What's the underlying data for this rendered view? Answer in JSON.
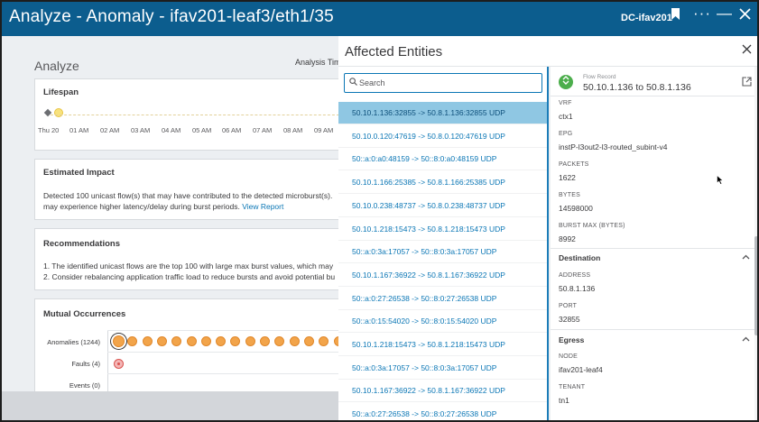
{
  "window": {
    "title": "Analyze - Anomaly - ifav201-leaf3/eth1/35",
    "site": "DC-ifav201"
  },
  "analyze": {
    "heading": "Analyze",
    "analysis_time_label": "Analysis Tim",
    "lifespan": {
      "title": "Lifespan",
      "time_labels": [
        "Thu 20",
        "01 AM",
        "02 AM",
        "03 AM",
        "04 AM",
        "05 AM",
        "06 AM",
        "07 AM",
        "08 AM",
        "09 AM"
      ]
    },
    "estimated_impact": {
      "title": "Estimated Impact",
      "line1": "Detected 100 unicast flow(s) that may have contributed to the detected microburst(s).",
      "line2": "may experience higher latency/delay during burst periods.",
      "link": "View Report"
    },
    "recommendations": {
      "title": "Recommendations",
      "line1": "1. The identified unicast flows are the top 100 with large max burst values, which may",
      "line2": "2. Consider rebalancing application traffic load to reduce bursts and avoid potential bu"
    },
    "mutual_occurrences": {
      "title": "Mutual Occurrences",
      "rows": [
        {
          "label": "Anomalies (1244)"
        },
        {
          "label": "Faults (4)"
        },
        {
          "label": "Events (0)"
        }
      ]
    }
  },
  "affected_entities": {
    "title": "Affected Entities",
    "search_placeholder": "Search",
    "flows": [
      "50.10.1.136:32855 -> 50.8.1.136:32855 UDP",
      "50.10.0.120:47619 -> 50.8.0.120:47619 UDP",
      "50::a:0:a0:48159 -> 50::8:0:a0:48159 UDP",
      "50.10.1.166:25385 -> 50.8.1.166:25385 UDP",
      "50.10.0.238:48737 -> 50.8.0.238:48737 UDP",
      "50.10.1.218:15473 -> 50.8.1.218:15473 UDP",
      "50::a:0:3a:17057 -> 50::8:0:3a:17057 UDP",
      "50.10.1.167:36922 -> 50.8.1.167:36922 UDP",
      "50::a:0:27:26538 -> 50::8:0:27:26538 UDP",
      "50::a:0:15:54020 -> 50::8:0:15:54020 UDP",
      "50.10.1.218:15473 -> 50.8.1.218:15473 UDP",
      "50::a:0:3a:17057 -> 50::8:0:3a:17057 UDP",
      "50.10.1.167:36922 -> 50.8.1.167:36922 UDP",
      "50::a:0:27:26538 -> 50::8:0:27:26538 UDP"
    ],
    "selected_index": 0
  },
  "flow_detail": {
    "record_label": "Flow Record",
    "record_value": "50.10.1.136 to 50.8.1.136",
    "fields": [
      {
        "label": "VRF",
        "value": "ctx1"
      },
      {
        "label": "EPG",
        "value": "instP-l3out2-l3-routed_subint-v4"
      },
      {
        "label": "PACKETS",
        "value": "1622"
      },
      {
        "label": "BYTES",
        "value": "14598000"
      },
      {
        "label": "BURST MAX (BYTES)",
        "value": "8992"
      }
    ],
    "destination": {
      "title": "Destination",
      "fields": [
        {
          "label": "ADDRESS",
          "value": "50.8.1.136"
        },
        {
          "label": "PORT",
          "value": "32855"
        }
      ]
    },
    "egress": {
      "title": "Egress",
      "fields": [
        {
          "label": "NODE",
          "value": "ifav201-leaf4"
        },
        {
          "label": "TENANT",
          "value": "tn1"
        }
      ]
    }
  },
  "colors": {
    "titlebar": "#0c5d8e",
    "link": "#0a76b5",
    "selected_row": "#8fc7e3",
    "anomaly": "#f2a44a"
  }
}
